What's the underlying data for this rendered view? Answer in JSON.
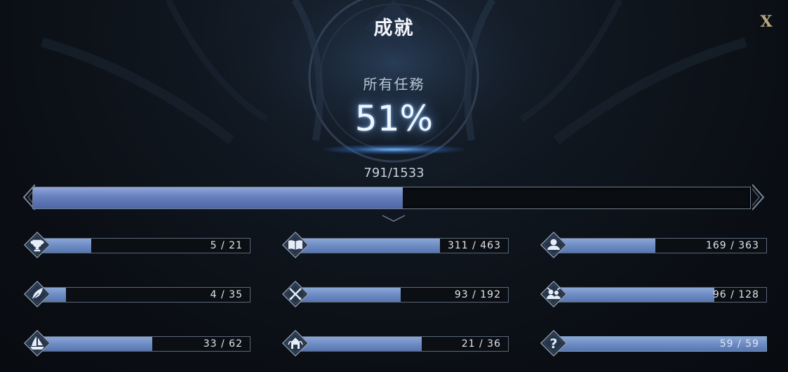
{
  "window": {
    "title": "成就",
    "close_label": "X"
  },
  "overall": {
    "label": "所有任務",
    "percent": "51%",
    "count": "791/1533",
    "progress": 0.516
  },
  "categories": [
    {
      "icon": "trophy-icon",
      "count": "5 / 21",
      "progress": 0.238
    },
    {
      "icon": "book-icon",
      "count": "311 / 463",
      "progress": 0.672
    },
    {
      "icon": "person-icon",
      "count": "169 / 363",
      "progress": 0.466
    },
    {
      "icon": "feather-icon",
      "count": "4 / 35",
      "progress": 0.114
    },
    {
      "icon": "crossed-swords-icon",
      "count": "93 / 192",
      "progress": 0.484
    },
    {
      "icon": "group-battle-icon",
      "count": "96 / 128",
      "progress": 0.75
    },
    {
      "icon": "ship-icon",
      "count": "33 / 62",
      "progress": 0.532
    },
    {
      "icon": "castle-crest-icon",
      "count": "21 / 36",
      "progress": 0.583
    },
    {
      "icon": "question-mark-icon",
      "count": "59 / 59",
      "progress": 1.0
    }
  ]
}
